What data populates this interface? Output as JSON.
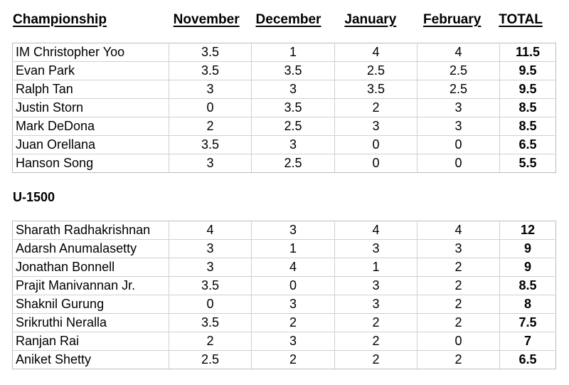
{
  "columns": {
    "name": "Championship",
    "months": [
      "November",
      "December",
      "January",
      "February"
    ],
    "total": "TOTAL"
  },
  "sections": [
    {
      "id": "championship",
      "title_shown": false,
      "title": "Championship",
      "rows": [
        {
          "name": "IM Christopher Yoo",
          "november": "3.5",
          "december": "1",
          "january": "4",
          "february": "4",
          "total": "11.5"
        },
        {
          "name": "Evan Park",
          "november": "3.5",
          "december": "3.5",
          "january": "2.5",
          "february": "2.5",
          "total": "9.5"
        },
        {
          "name": "Ralph Tan",
          "november": "3",
          "december": "3",
          "january": "3.5",
          "february": "2.5",
          "total": "9.5"
        },
        {
          "name": "Justin Storn",
          "november": "0",
          "december": "3.5",
          "january": "2",
          "february": "3",
          "total": "8.5"
        },
        {
          "name": "Mark DeDona",
          "november": "2",
          "december": "2.5",
          "january": "3",
          "february": "3",
          "total": "8.5"
        },
        {
          "name": "Juan Orellana",
          "november": "3.5",
          "december": "3",
          "january": "0",
          "february": "0",
          "total": "6.5"
        },
        {
          "name": "Hanson Song",
          "november": "3",
          "december": "2.5",
          "january": "0",
          "february": "0",
          "total": "5.5"
        }
      ]
    },
    {
      "id": "u1500",
      "title_shown": true,
      "title": "U-1500",
      "rows": [
        {
          "name": "Sharath Radhakrishnan",
          "november": "4",
          "december": "3",
          "january": "4",
          "february": "4",
          "total": "12"
        },
        {
          "name": "Adarsh Anumalasetty",
          "november": "3",
          "december": "1",
          "january": "3",
          "february": "3",
          "total": "9"
        },
        {
          "name": "Jonathan Bonnell",
          "november": "3",
          "december": "4",
          "january": "1",
          "february": "2",
          "total": "9"
        },
        {
          "name": "Prajit Manivannan Jr.",
          "november": "3.5",
          "december": "0",
          "january": "3",
          "february": "2",
          "total": "8.5"
        },
        {
          "name": "Shaknil Gurung",
          "november": "0",
          "december": "3",
          "january": "3",
          "february": "2",
          "total": "8"
        },
        {
          "name": "Srikruthi Neralla",
          "november": "3.5",
          "december": "2",
          "january": "2",
          "february": "2",
          "total": "7.5"
        },
        {
          "name": "Ranjan Rai",
          "november": "2",
          "december": "3",
          "january": "2",
          "february": "0",
          "total": "7"
        },
        {
          "name": "Aniket Shetty",
          "november": "2.5",
          "december": "2",
          "january": "2",
          "february": "2",
          "total": "6.5"
        }
      ]
    }
  ],
  "colors": {
    "text": "#000000",
    "grid_line": "#d0d0d0",
    "grid_outer": "#bdbdbd",
    "background": "#ffffff"
  }
}
